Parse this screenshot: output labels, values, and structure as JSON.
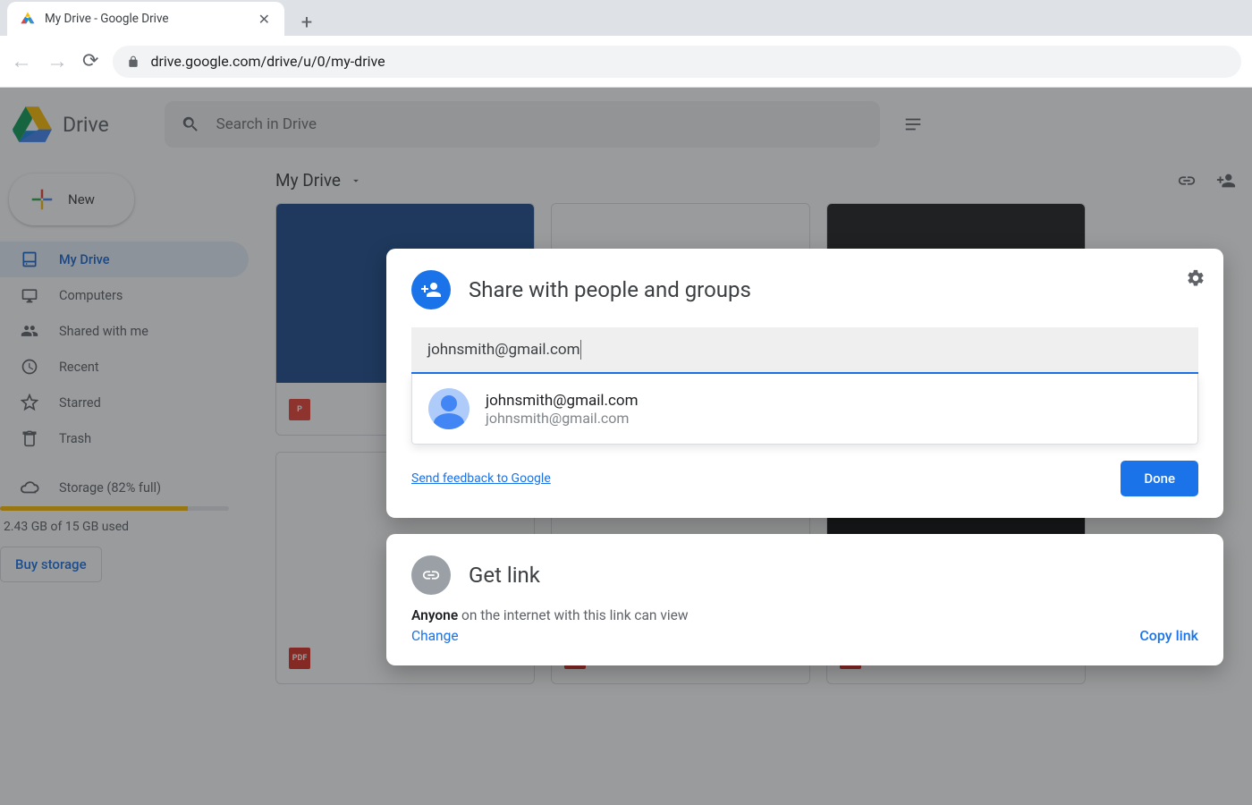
{
  "browser": {
    "tab_title": "My Drive - Google Drive",
    "url": "drive.google.com/drive/u/0/my-drive"
  },
  "header": {
    "app_name": "Drive",
    "search_placeholder": "Search in Drive"
  },
  "sidebar": {
    "new_label": "New",
    "items": [
      {
        "label": "My Drive"
      },
      {
        "label": "Computers"
      },
      {
        "label": "Shared with me"
      },
      {
        "label": "Recent"
      },
      {
        "label": "Starred"
      },
      {
        "label": "Trash"
      }
    ],
    "storage_label": "Storage (82% full)",
    "storage_pct": 82,
    "storage_used": "2.43 GB of 15 GB used",
    "buy_label": "Buy storage"
  },
  "content": {
    "breadcrumb": "My Drive"
  },
  "share_modal": {
    "title": "Share with people and groups",
    "input_value": "johnsmith@gmail.com",
    "suggestion": {
      "name": "johnsmith@gmail.com",
      "email": "johnsmith@gmail.com"
    },
    "feedback": "Send feedback to Google",
    "done": "Done"
  },
  "link_modal": {
    "title": "Get link",
    "desc_bold": "Anyone",
    "desc_rest": " on the internet with this link can view",
    "change": "Change",
    "copy": "Copy link"
  }
}
